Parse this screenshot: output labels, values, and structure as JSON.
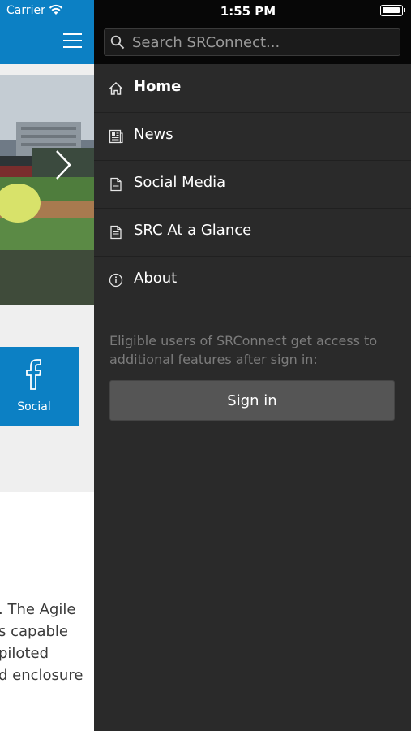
{
  "status_bar": {
    "carrier": "Carrier",
    "time": "1:55 PM"
  },
  "main": {
    "social_tile_label": "Social",
    "body_lines": [
      ". The Agile",
      "s capable",
      "piloted",
      "d enclosure"
    ]
  },
  "drawer": {
    "search_placeholder": "Search SRConnect...",
    "menu": [
      {
        "label": "Home",
        "icon": "home-icon",
        "active": true
      },
      {
        "label": "News",
        "icon": "news-icon",
        "active": false
      },
      {
        "label": "Social Media",
        "icon": "document-icon",
        "active": false
      },
      {
        "label": "SRC At a Glance",
        "icon": "document-icon",
        "active": false
      },
      {
        "label": "About",
        "icon": "info-icon",
        "active": false
      }
    ],
    "info_text": "Eligible users of SRConnect get access to additional features after sign in:",
    "signin_label": "Sign in"
  },
  "colors": {
    "brand_blue": "#0c80c4",
    "drawer_bg": "#2a2a2a"
  }
}
